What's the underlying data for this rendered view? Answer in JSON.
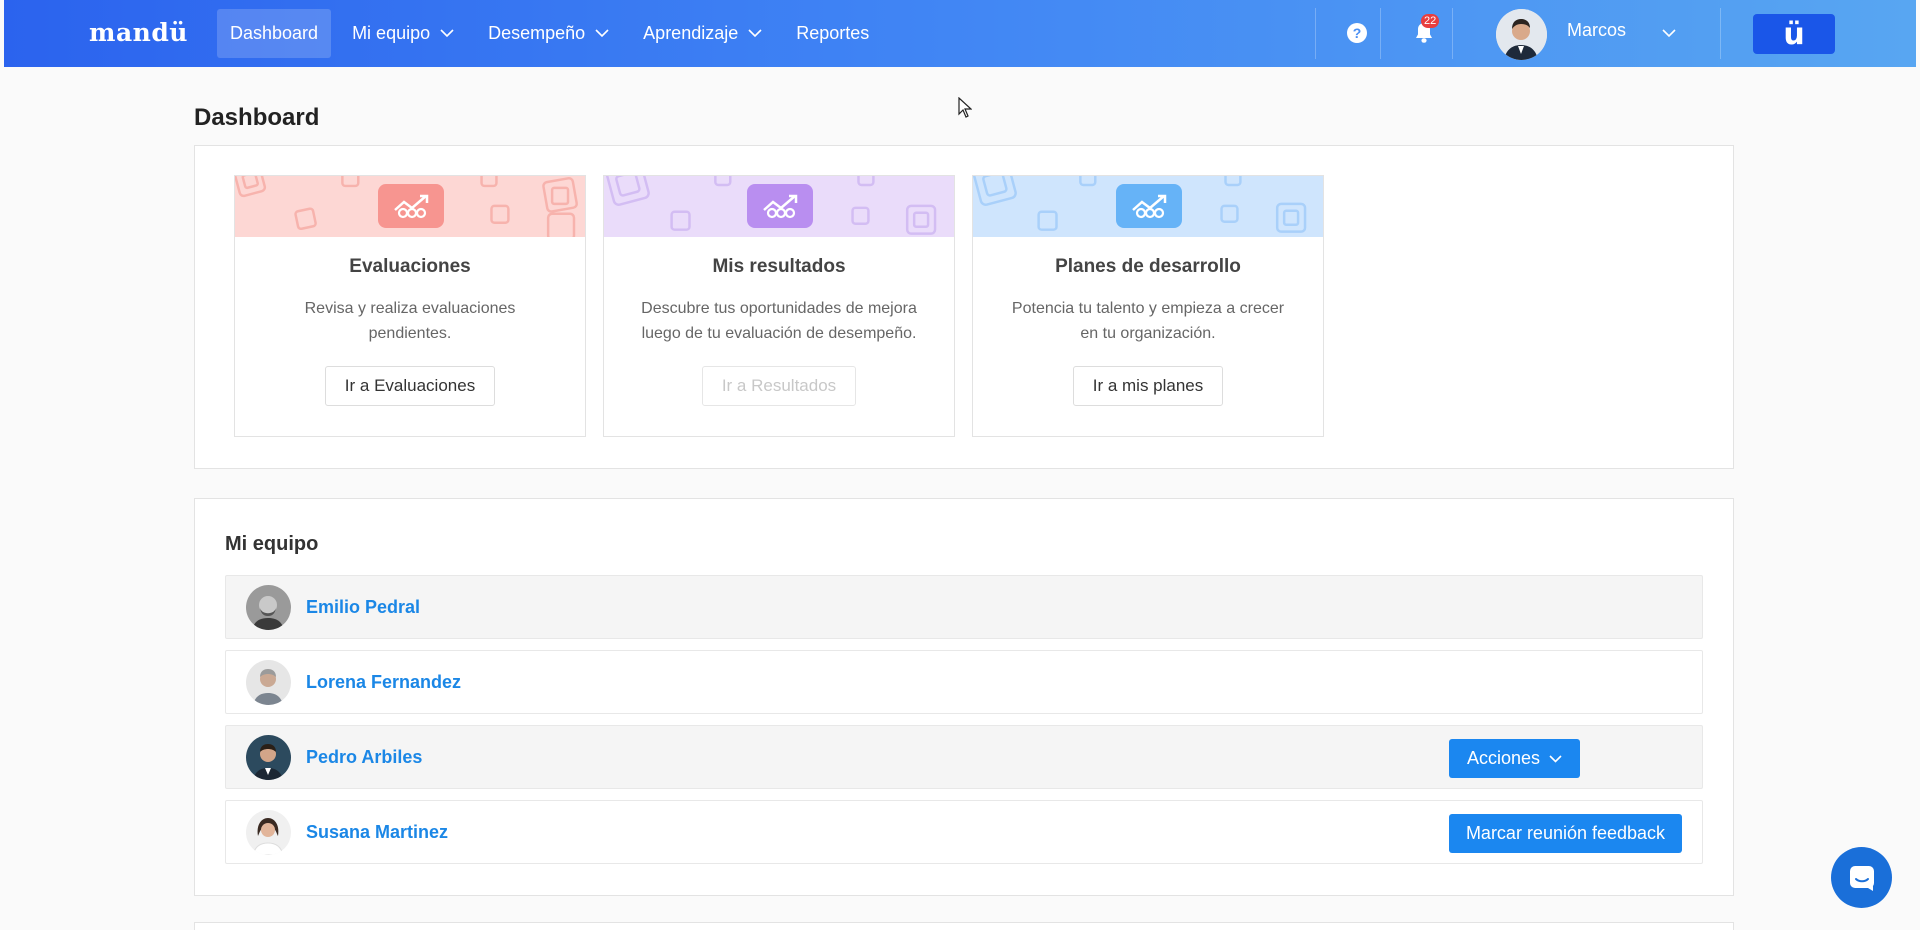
{
  "header": {
    "logo": "mandü",
    "nav": [
      {
        "label": "Dashboard",
        "active": true,
        "dropdown": false
      },
      {
        "label": "Mi equipo",
        "active": false,
        "dropdown": true
      },
      {
        "label": "Desempeño",
        "active": false,
        "dropdown": true
      },
      {
        "label": "Aprendizaje",
        "active": false,
        "dropdown": true
      },
      {
        "label": "Reportes",
        "active": false,
        "dropdown": false
      }
    ],
    "help_icon": "?",
    "notifications_count": "22",
    "user_name": "Marcos",
    "brand_button": "ü"
  },
  "page": {
    "title": "Dashboard"
  },
  "cards": [
    {
      "title": "Evaluaciones",
      "description": "Revisa y realiza evaluaciones pendientes.",
      "button": "Ir a Evaluaciones",
      "disabled": false,
      "banner_color": "#fdd7d4",
      "icon_color": "#f79590"
    },
    {
      "title": "Mis resultados",
      "description": "Descubre tus oportunidades de mejora luego de tu evaluación de desempeño.",
      "button": "Ir a Resultados",
      "disabled": true,
      "banner_color": "#eadcfa",
      "icon_color": "#b98ef0"
    },
    {
      "title": "Planes de desarrollo",
      "description": "Potencia tu talento y empieza a crecer en tu organización.",
      "button": "Ir a mis planes",
      "disabled": false,
      "banner_color": "#cfe5fd",
      "icon_color": "#66b3f7"
    }
  ],
  "team": {
    "title": "Mi equipo",
    "members": [
      {
        "name": "Emilio Pedral",
        "action": ""
      },
      {
        "name": "Lorena Fernandez",
        "action": ""
      },
      {
        "name": "Pedro Arbiles",
        "action": "Acciones"
      },
      {
        "name": "Susana Martinez",
        "action": "Marcar reunión feedback"
      }
    ]
  },
  "colors": {
    "accent": "#1b87f0",
    "link": "#1b87e6",
    "nav_start": "#2b63ee",
    "nav_end": "#58a6f2"
  },
  "icons": {
    "help": "question-circle-icon",
    "bell": "bell-icon",
    "chat": "chat-icon",
    "chevron": "chevron-down-icon"
  }
}
